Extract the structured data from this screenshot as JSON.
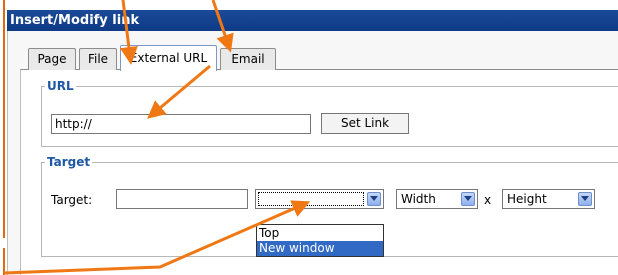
{
  "window": {
    "title": "Insert/Modify link"
  },
  "tabs": [
    {
      "label": "Page",
      "active": false
    },
    {
      "label": "File",
      "active": false
    },
    {
      "label": "External URL",
      "active": true
    },
    {
      "label": "Email",
      "active": false
    }
  ],
  "url_section": {
    "legend": "URL",
    "url_value": "http://",
    "set_link_label": "Set Link"
  },
  "target_section": {
    "legend": "Target",
    "target_label": "Target:",
    "target_value": "",
    "target_select_value": "",
    "width_label": "Width",
    "times_sign": "x",
    "height_label": "Height"
  },
  "dropdown": {
    "options": [
      {
        "label": "Top",
        "selected": false
      },
      {
        "label": "New window",
        "selected": true
      }
    ]
  },
  "annotation": {
    "arrow_color": "#f07814"
  },
  "colors": {
    "titlebar": "#0e3a86",
    "legend_text": "#1f56a6",
    "selection": "#316ac5"
  }
}
